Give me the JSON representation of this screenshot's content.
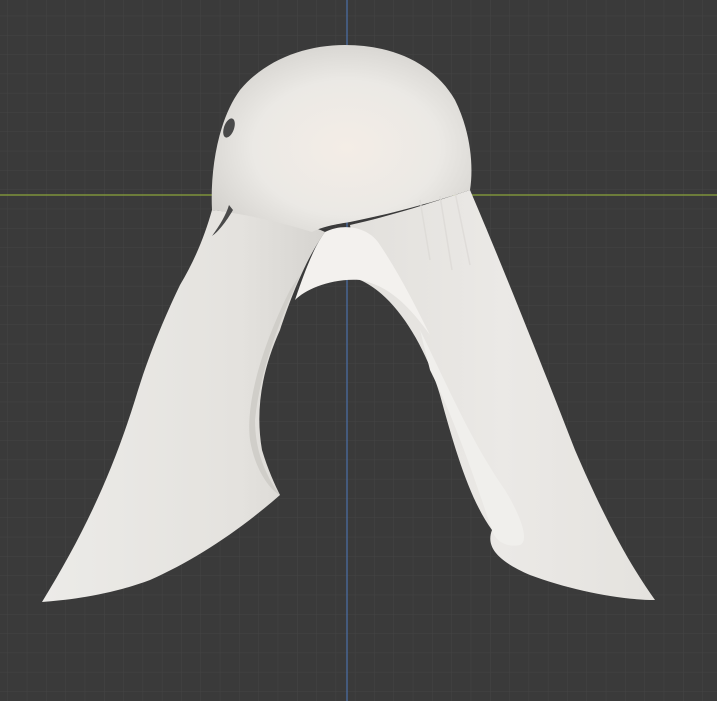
{
  "viewport": {
    "background_color": "#3a3a3a",
    "grid_minor_color": "#434343",
    "grid_major_color": "#4c4c4c",
    "x_axis_color": "#8aa33a",
    "y_axis_color": "#4a6fa8"
  },
  "object": {
    "name": "ghost-mesh",
    "body_color": "#e9e7e3",
    "shade_color": "#cfccc6",
    "highlight_color": "#f6f0ea",
    "face_color": "#4a4a4a"
  }
}
